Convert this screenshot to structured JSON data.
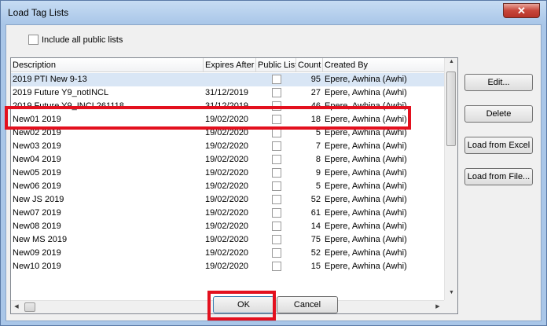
{
  "window": {
    "title": "Load Tag Lists",
    "close_glyph": "✕"
  },
  "include_public": {
    "label": "Include all public lists",
    "checked": false
  },
  "columns": [
    "Description",
    "Expires After",
    "Public List",
    "Count",
    "Created By"
  ],
  "rows": [
    {
      "desc": "2019 PTI New 9-13",
      "exp": "",
      "pub": false,
      "count": "95",
      "by": "Epere, Awhina (Awhi)"
    },
    {
      "desc": "2019 Future Y9_notINCL",
      "exp": "31/12/2019",
      "pub": false,
      "count": "27",
      "by": "Epere, Awhina (Awhi)"
    },
    {
      "desc": "2019 Future Y9_INCL261118",
      "exp": "31/12/2019",
      "pub": false,
      "count": "46",
      "by": "Epere, Awhina (Awhi)"
    },
    {
      "desc": "New01 2019",
      "exp": "19/02/2020",
      "pub": false,
      "count": "18",
      "by": "Epere, Awhina (Awhi)"
    },
    {
      "desc": "New02 2019",
      "exp": "19/02/2020",
      "pub": false,
      "count": "5",
      "by": "Epere, Awhina (Awhi)"
    },
    {
      "desc": "New03 2019",
      "exp": "19/02/2020",
      "pub": false,
      "count": "7",
      "by": "Epere, Awhina (Awhi)"
    },
    {
      "desc": "New04 2019",
      "exp": "19/02/2020",
      "pub": false,
      "count": "8",
      "by": "Epere, Awhina (Awhi)"
    },
    {
      "desc": "New05 2019",
      "exp": "19/02/2020",
      "pub": false,
      "count": "9",
      "by": "Epere, Awhina (Awhi)"
    },
    {
      "desc": "New06 2019",
      "exp": "19/02/2020",
      "pub": false,
      "count": "5",
      "by": "Epere, Awhina (Awhi)"
    },
    {
      "desc": "New JS 2019",
      "exp": "19/02/2020",
      "pub": false,
      "count": "52",
      "by": "Epere, Awhina (Awhi)"
    },
    {
      "desc": "New07 2019",
      "exp": "19/02/2020",
      "pub": false,
      "count": "61",
      "by": "Epere, Awhina (Awhi)"
    },
    {
      "desc": "New08 2019",
      "exp": "19/02/2020",
      "pub": false,
      "count": "14",
      "by": "Epere, Awhina (Awhi)"
    },
    {
      "desc": "New MS 2019",
      "exp": "19/02/2020",
      "pub": false,
      "count": "75",
      "by": "Epere, Awhina (Awhi)"
    },
    {
      "desc": "New09 2019",
      "exp": "19/02/2020",
      "pub": false,
      "count": "52",
      "by": "Epere, Awhina (Awhi)"
    },
    {
      "desc": "New10 2019",
      "exp": "19/02/2020",
      "pub": false,
      "count": "15",
      "by": "Epere, Awhina (Awhi)"
    }
  ],
  "selected_row": 0,
  "buttons": {
    "edit": "Edit...",
    "delete": "Delete",
    "load_excel": "Load from Excel",
    "load_file": "Load from File...",
    "ok": "OK",
    "cancel": "Cancel"
  },
  "colors": {
    "highlight": "#e3101e",
    "selection": "#d9e6f5"
  }
}
